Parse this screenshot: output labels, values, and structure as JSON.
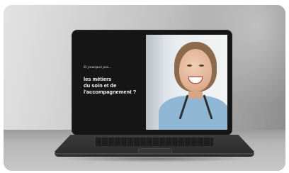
{
  "screen": {
    "kicker": "Et pourquoi pas...",
    "headline_lines": [
      "les métiers",
      "du soin et de",
      "l'accompagnement ?"
    ]
  },
  "icons": [
    "laptop-icon"
  ],
  "colors": {
    "screen_text": "#ffffff",
    "scrubs": "#8fb7d4"
  }
}
